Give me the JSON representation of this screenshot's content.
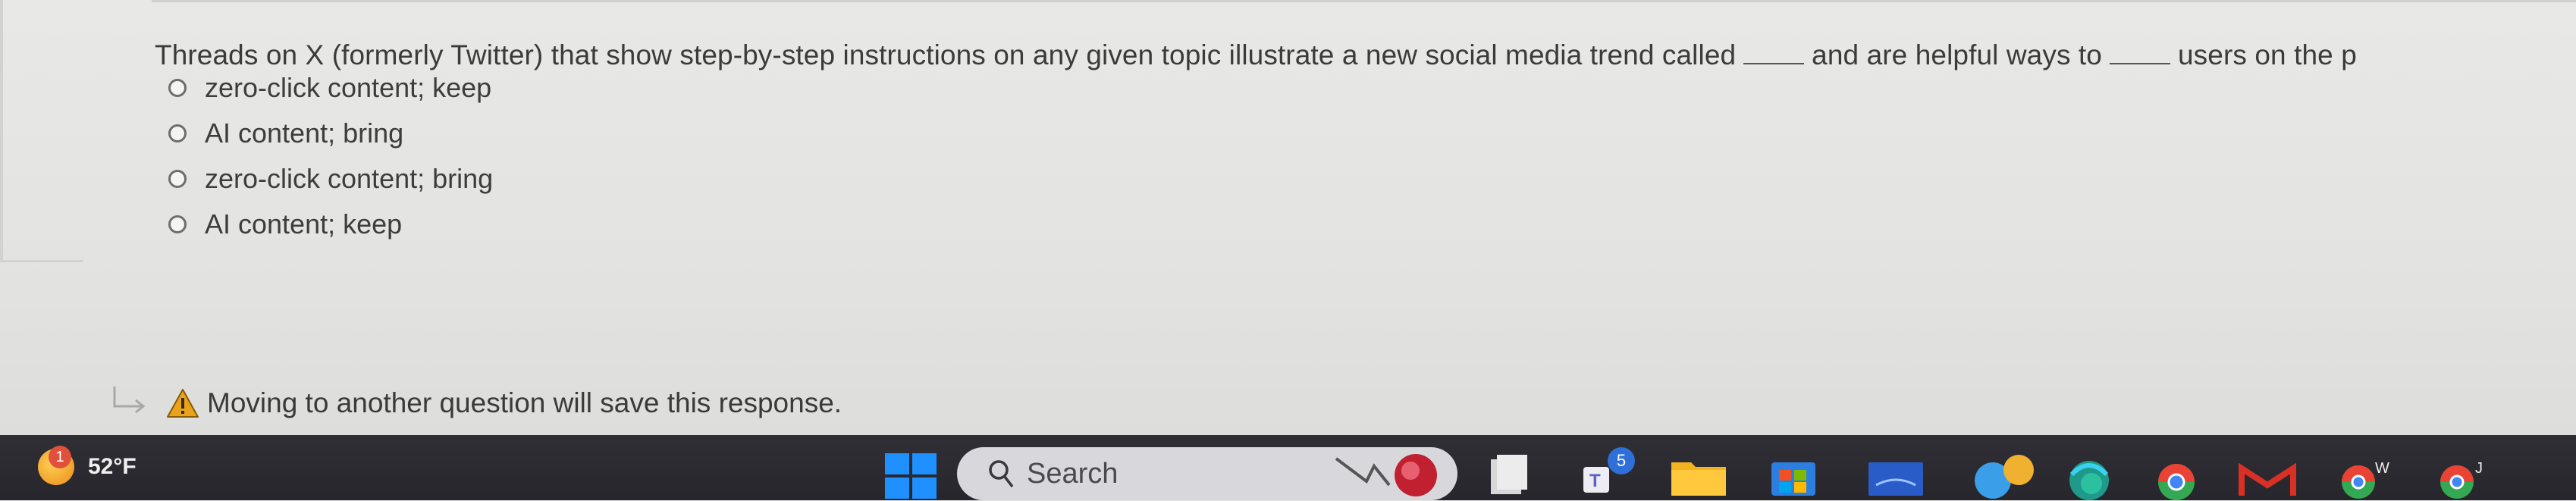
{
  "question": {
    "text_part1": "Threads on X (formerly Twitter) that show step-by-step instructions on any given topic illustrate a new social media trend called",
    "text_part2": "and are helpful ways to",
    "text_part3": "users on the p"
  },
  "options": [
    {
      "label": "zero-click content; keep"
    },
    {
      "label": "AI content; bring"
    },
    {
      "label": "zero-click content; bring"
    },
    {
      "label": "AI content; keep"
    }
  ],
  "notice": {
    "text": "Moving to another question will save this response."
  },
  "taskbar": {
    "weather_badge": "1",
    "weather_temp": "52°F",
    "search_label": "Search",
    "teams_badge": "5"
  },
  "colors": {
    "taskbar": "#26262c",
    "warning": "#e8a31c",
    "start": "#1e90ff"
  }
}
